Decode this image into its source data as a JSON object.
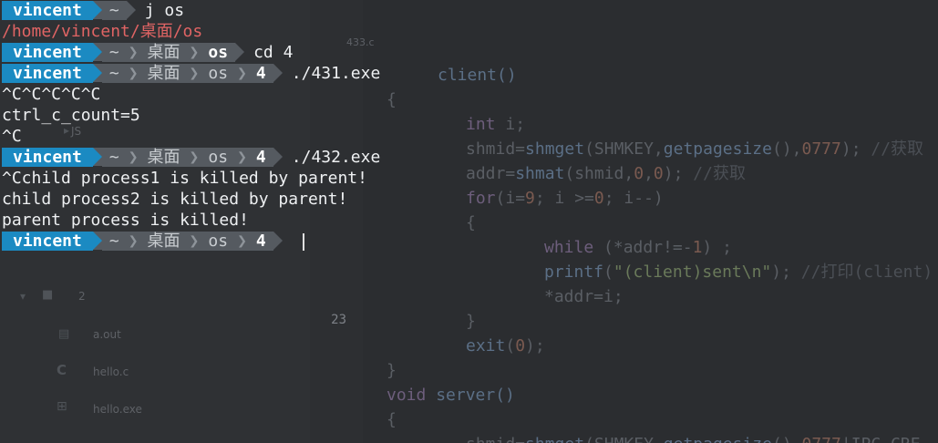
{
  "terminal": {
    "lines": [
      {
        "type": "prompt",
        "user": "vincent",
        "dirs": [
          "~"
        ],
        "cmd": "j os"
      },
      {
        "type": "path",
        "text": "/home/vincent/桌面/os"
      },
      {
        "type": "prompt",
        "user": "vincent",
        "dirs": [
          "~",
          "桌面",
          "os"
        ],
        "cmd": "cd 4"
      },
      {
        "type": "prompt",
        "user": "vincent",
        "dirs": [
          "~",
          "桌面",
          "os",
          "4"
        ],
        "cmd": "./431.exe"
      },
      {
        "type": "output",
        "text": "^C^C^C^C^C"
      },
      {
        "type": "output",
        "text": "ctrl_c_count=5"
      },
      {
        "type": "output",
        "text": "^C"
      },
      {
        "type": "prompt",
        "user": "vincent",
        "dirs": [
          "~",
          "桌面",
          "os",
          "4"
        ],
        "cmd": "./432.exe"
      },
      {
        "type": "output",
        "text": "^Cchild process1 is killed by parent!"
      },
      {
        "type": "output",
        "text": "child process2 is killed by parent!"
      },
      {
        "type": "output",
        "text": "parent process is killed!"
      },
      {
        "type": "prompt",
        "user": "vincent",
        "dirs": [
          "~",
          "桌面",
          "os",
          "4"
        ],
        "cmd": "",
        "cursor": true
      }
    ]
  },
  "editor_background": {
    "tab": "433.c",
    "line_number_current": "23",
    "files": [
      "a.out",
      "hello.c",
      "hello.exe",
      "JS",
      "2"
    ]
  }
}
